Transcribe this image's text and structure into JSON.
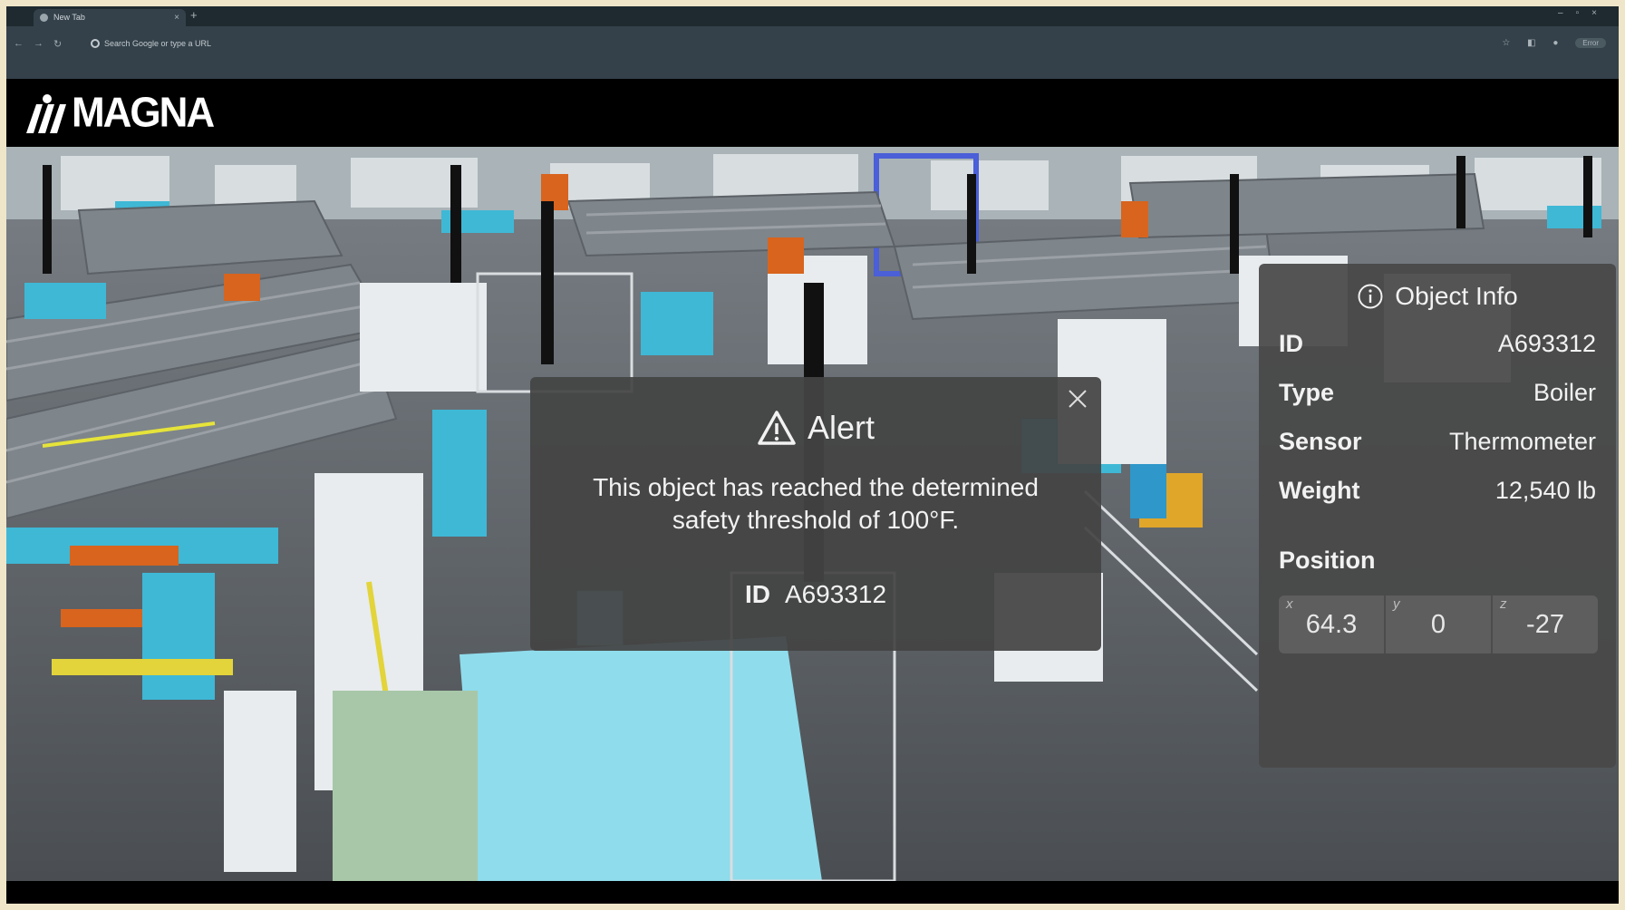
{
  "browser": {
    "tab_title": "New Tab",
    "omnibox_placeholder": "Search Google or type a URL",
    "profile_label": "Error"
  },
  "app": {
    "logo_text": "MAGNA"
  },
  "alert": {
    "title": "Alert",
    "message": "This object has reached the determined safety threshold of 100°F.",
    "id_label": "ID",
    "id_value": "A693312"
  },
  "object_info": {
    "title": "Object Info",
    "fields": [
      {
        "label": "ID",
        "value": "A693312"
      },
      {
        "label": "Type",
        "value": "Boiler"
      },
      {
        "label": "Sensor",
        "value": "Thermometer"
      },
      {
        "label": "Weight",
        "value": "12,540 lb"
      }
    ],
    "position_label": "Position",
    "position": [
      {
        "axis": "x",
        "value": "64.3"
      },
      {
        "axis": "y",
        "value": "0"
      },
      {
        "axis": "z",
        "value": "-27"
      }
    ]
  },
  "colors": {
    "panel_bg": "#484848",
    "cyan_machinery": "#3fb8d6",
    "orange_robots": "#d8641e"
  }
}
